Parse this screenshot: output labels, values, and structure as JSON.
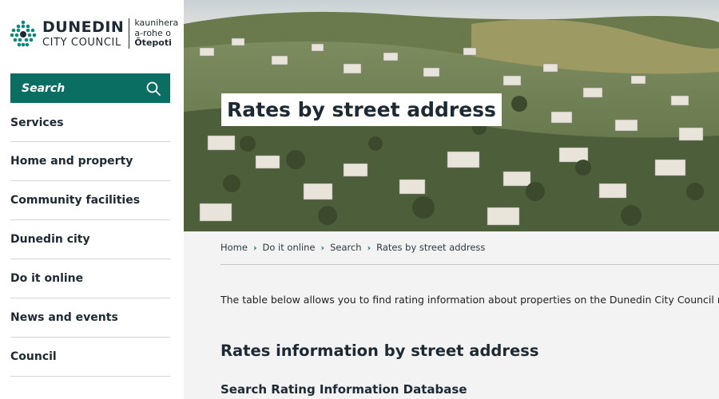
{
  "brand": {
    "name_line1": "DUNEDIN",
    "name_line2": "CITY COUNCIL",
    "maori_line1": "kaunihera",
    "maori_line2": "a-rohe o",
    "maori_line3": "Ōtepoti"
  },
  "search": {
    "label": "Search"
  },
  "nav": {
    "items": [
      "Services",
      "Home and property",
      "Community facilities",
      "Dunedin city",
      "Do it online",
      "News and events",
      "Council"
    ]
  },
  "hero": {
    "title": "Rates by street address"
  },
  "breadcrumb": {
    "items": [
      "Home",
      "Do it online",
      "Search",
      "Rates by street address"
    ]
  },
  "content": {
    "intro": "The table below allows you to find rating information about properties on the Dunedin City Council rating information database.",
    "heading": "Rates information by street address",
    "subheading": "Search Rating Information Database"
  },
  "colors": {
    "accent": "#0b6e63",
    "text": "#1d2a33",
    "background": "#f3f3f3"
  }
}
